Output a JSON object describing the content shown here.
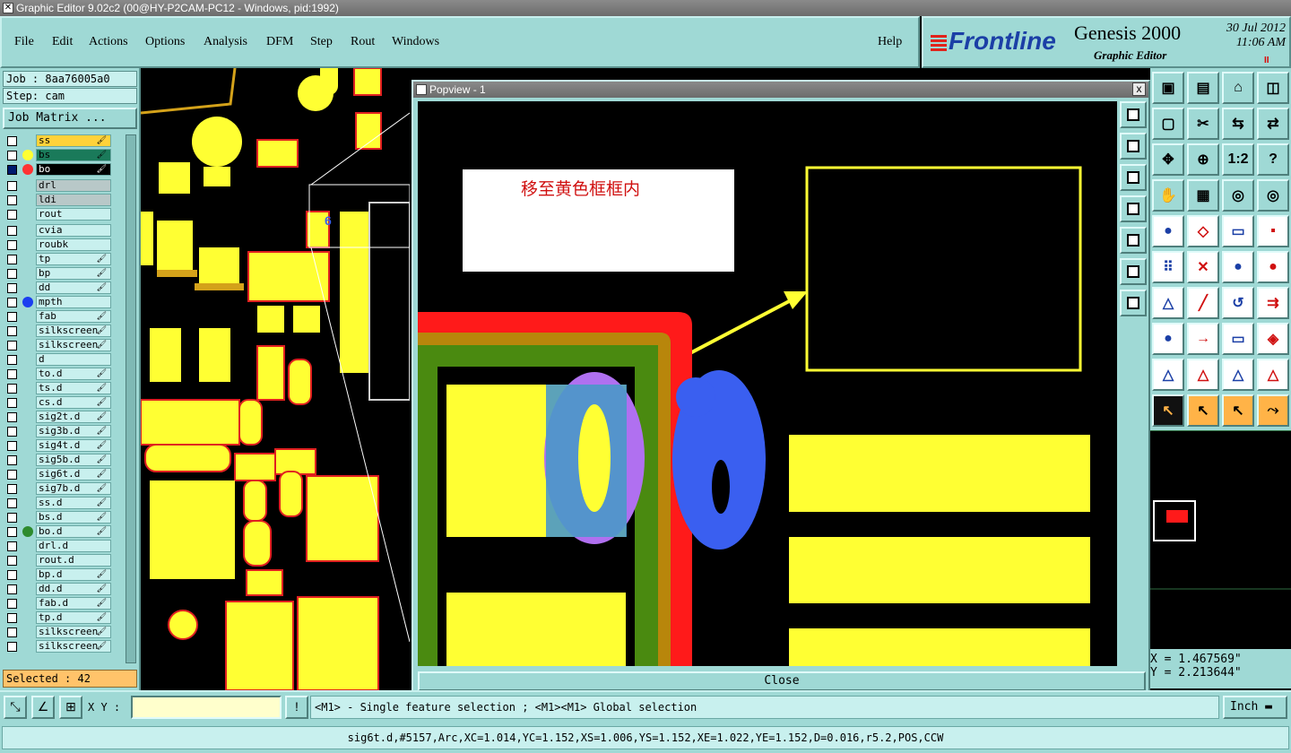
{
  "window": {
    "title": "Graphic Editor 9.02c2 (00@HY-P2CAM-PC12 - Windows, pid:1992)"
  },
  "menu": {
    "items": [
      {
        "label": "File"
      },
      {
        "label": "Edit"
      },
      {
        "label": "Actions"
      },
      {
        "label": "Options"
      },
      {
        "label": "Analysis"
      },
      {
        "label": "DFM"
      },
      {
        "label": "Step"
      },
      {
        "label": "Rout"
      },
      {
        "label": "Windows"
      },
      {
        "label": "Help"
      }
    ]
  },
  "brand": {
    "logo": "Frontline",
    "product": "Genesis 2000",
    "subtitle": "Graphic Editor",
    "date": "30 Jul 2012",
    "time": "11:06 AM",
    "pause": "II"
  },
  "left": {
    "job": "Job : 8aa76005a0",
    "step": "Step: cam",
    "job_matrix": "Job Matrix ...",
    "layers": [
      {
        "name": "ss",
        "style": "yellow",
        "brush": true
      },
      {
        "name": "bs",
        "style": "green",
        "dot": "#ffff33",
        "brush": true
      },
      {
        "name": "bo",
        "style": "sel",
        "dot": "#ff3333",
        "checked": true,
        "brush": true
      },
      {
        "name": "drl",
        "style": "gray"
      },
      {
        "name": "ldi",
        "style": "gray"
      },
      {
        "name": "rout",
        "style": ""
      },
      {
        "name": "cvia",
        "style": ""
      },
      {
        "name": "roubk",
        "style": ""
      },
      {
        "name": "tp",
        "style": "",
        "brush": true
      },
      {
        "name": "bp",
        "style": "",
        "brush": true
      },
      {
        "name": "dd",
        "style": "",
        "brush": true
      },
      {
        "name": "mpth",
        "style": "",
        "dot": "#1b3ff0"
      },
      {
        "name": "fab",
        "style": "",
        "brush": true
      },
      {
        "name": "silkscreen",
        "style": "",
        "brush": true
      },
      {
        "name": "silkscreen",
        "style": "",
        "brush": true
      },
      {
        "name": "d",
        "style": ""
      },
      {
        "name": "to.d",
        "style": "",
        "brush": true
      },
      {
        "name": "ts.d",
        "style": "",
        "brush": true
      },
      {
        "name": "cs.d",
        "style": "",
        "brush": true
      },
      {
        "name": "sig2t.d",
        "style": "",
        "brush": true
      },
      {
        "name": "sig3b.d",
        "style": "",
        "brush": true
      },
      {
        "name": "sig4t.d",
        "style": "",
        "brush": true
      },
      {
        "name": "sig5b.d",
        "style": "",
        "brush": true
      },
      {
        "name": "sig6t.d",
        "style": "",
        "brush": true
      },
      {
        "name": "sig7b.d",
        "style": "",
        "brush": true
      },
      {
        "name": "ss.d",
        "style": "",
        "brush": true
      },
      {
        "name": "bs.d",
        "style": "",
        "brush": true
      },
      {
        "name": "bo.d",
        "style": "",
        "dot": "#2e8b2e",
        "brush": true
      },
      {
        "name": "drl.d",
        "style": ""
      },
      {
        "name": "rout.d",
        "style": ""
      },
      {
        "name": "bp.d",
        "style": "",
        "brush": true
      },
      {
        "name": "dd.d",
        "style": "",
        "brush": true
      },
      {
        "name": "fab.d",
        "style": "",
        "brush": true
      },
      {
        "name": "tp.d",
        "style": "",
        "brush": true
      },
      {
        "name": "silkscreen",
        "style": "",
        "brush": true
      },
      {
        "name": "silkscreen",
        "style": "",
        "brush": true
      }
    ],
    "selected": "Selected : 42"
  },
  "popview": {
    "title": "Popview - 1",
    "annotation": "移至黄色框框内",
    "close_label": "Close",
    "close_icon": "x"
  },
  "right": {
    "coord_x": "X = 1.467569\"",
    "coord_y": "Y = 2.213644\""
  },
  "bottom": {
    "xy_label": "X Y :",
    "xy_value": "",
    "hint": "<M1> - Single feature selection ; <M1><M1> Global selection",
    "unit": "Inch",
    "status": "sig6t.d,#5157,Arc,XC=1.014,YC=1.152,XS=1.006,YS=1.152,XE=1.022,YE=1.152,D=0.016,r5.2,POS,CCW"
  },
  "colors": {
    "panel": "#9fd9d5",
    "pad": "#ffff33",
    "outline_red": "#ff2020",
    "outline_green": "#4a8a10",
    "outline_gold": "#b8860b",
    "blue_text": "#3a5ff0",
    "violet": "#b070f0"
  }
}
